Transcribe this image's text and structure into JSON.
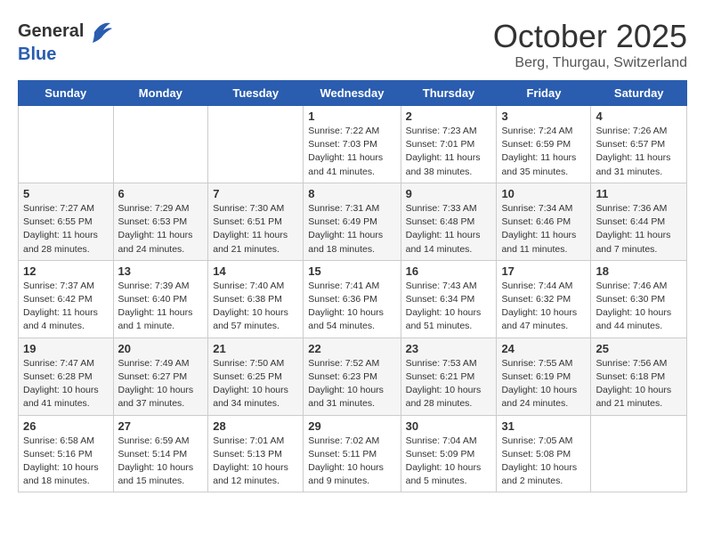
{
  "logo": {
    "general": "General",
    "blue": "Blue"
  },
  "title": "October 2025",
  "location": "Berg, Thurgau, Switzerland",
  "days_header": [
    "Sunday",
    "Monday",
    "Tuesday",
    "Wednesday",
    "Thursday",
    "Friday",
    "Saturday"
  ],
  "weeks": [
    [
      {
        "num": "",
        "info": ""
      },
      {
        "num": "",
        "info": ""
      },
      {
        "num": "",
        "info": ""
      },
      {
        "num": "1",
        "info": "Sunrise: 7:22 AM\nSunset: 7:03 PM\nDaylight: 11 hours\nand 41 minutes."
      },
      {
        "num": "2",
        "info": "Sunrise: 7:23 AM\nSunset: 7:01 PM\nDaylight: 11 hours\nand 38 minutes."
      },
      {
        "num": "3",
        "info": "Sunrise: 7:24 AM\nSunset: 6:59 PM\nDaylight: 11 hours\nand 35 minutes."
      },
      {
        "num": "4",
        "info": "Sunrise: 7:26 AM\nSunset: 6:57 PM\nDaylight: 11 hours\nand 31 minutes."
      }
    ],
    [
      {
        "num": "5",
        "info": "Sunrise: 7:27 AM\nSunset: 6:55 PM\nDaylight: 11 hours\nand 28 minutes."
      },
      {
        "num": "6",
        "info": "Sunrise: 7:29 AM\nSunset: 6:53 PM\nDaylight: 11 hours\nand 24 minutes."
      },
      {
        "num": "7",
        "info": "Sunrise: 7:30 AM\nSunset: 6:51 PM\nDaylight: 11 hours\nand 21 minutes."
      },
      {
        "num": "8",
        "info": "Sunrise: 7:31 AM\nSunset: 6:49 PM\nDaylight: 11 hours\nand 18 minutes."
      },
      {
        "num": "9",
        "info": "Sunrise: 7:33 AM\nSunset: 6:48 PM\nDaylight: 11 hours\nand 14 minutes."
      },
      {
        "num": "10",
        "info": "Sunrise: 7:34 AM\nSunset: 6:46 PM\nDaylight: 11 hours\nand 11 minutes."
      },
      {
        "num": "11",
        "info": "Sunrise: 7:36 AM\nSunset: 6:44 PM\nDaylight: 11 hours\nand 7 minutes."
      }
    ],
    [
      {
        "num": "12",
        "info": "Sunrise: 7:37 AM\nSunset: 6:42 PM\nDaylight: 11 hours\nand 4 minutes."
      },
      {
        "num": "13",
        "info": "Sunrise: 7:39 AM\nSunset: 6:40 PM\nDaylight: 11 hours\nand 1 minute."
      },
      {
        "num": "14",
        "info": "Sunrise: 7:40 AM\nSunset: 6:38 PM\nDaylight: 10 hours\nand 57 minutes."
      },
      {
        "num": "15",
        "info": "Sunrise: 7:41 AM\nSunset: 6:36 PM\nDaylight: 10 hours\nand 54 minutes."
      },
      {
        "num": "16",
        "info": "Sunrise: 7:43 AM\nSunset: 6:34 PM\nDaylight: 10 hours\nand 51 minutes."
      },
      {
        "num": "17",
        "info": "Sunrise: 7:44 AM\nSunset: 6:32 PM\nDaylight: 10 hours\nand 47 minutes."
      },
      {
        "num": "18",
        "info": "Sunrise: 7:46 AM\nSunset: 6:30 PM\nDaylight: 10 hours\nand 44 minutes."
      }
    ],
    [
      {
        "num": "19",
        "info": "Sunrise: 7:47 AM\nSunset: 6:28 PM\nDaylight: 10 hours\nand 41 minutes."
      },
      {
        "num": "20",
        "info": "Sunrise: 7:49 AM\nSunset: 6:27 PM\nDaylight: 10 hours\nand 37 minutes."
      },
      {
        "num": "21",
        "info": "Sunrise: 7:50 AM\nSunset: 6:25 PM\nDaylight: 10 hours\nand 34 minutes."
      },
      {
        "num": "22",
        "info": "Sunrise: 7:52 AM\nSunset: 6:23 PM\nDaylight: 10 hours\nand 31 minutes."
      },
      {
        "num": "23",
        "info": "Sunrise: 7:53 AM\nSunset: 6:21 PM\nDaylight: 10 hours\nand 28 minutes."
      },
      {
        "num": "24",
        "info": "Sunrise: 7:55 AM\nSunset: 6:19 PM\nDaylight: 10 hours\nand 24 minutes."
      },
      {
        "num": "25",
        "info": "Sunrise: 7:56 AM\nSunset: 6:18 PM\nDaylight: 10 hours\nand 21 minutes."
      }
    ],
    [
      {
        "num": "26",
        "info": "Sunrise: 6:58 AM\nSunset: 5:16 PM\nDaylight: 10 hours\nand 18 minutes."
      },
      {
        "num": "27",
        "info": "Sunrise: 6:59 AM\nSunset: 5:14 PM\nDaylight: 10 hours\nand 15 minutes."
      },
      {
        "num": "28",
        "info": "Sunrise: 7:01 AM\nSunset: 5:13 PM\nDaylight: 10 hours\nand 12 minutes."
      },
      {
        "num": "29",
        "info": "Sunrise: 7:02 AM\nSunset: 5:11 PM\nDaylight: 10 hours\nand 9 minutes."
      },
      {
        "num": "30",
        "info": "Sunrise: 7:04 AM\nSunset: 5:09 PM\nDaylight: 10 hours\nand 5 minutes."
      },
      {
        "num": "31",
        "info": "Sunrise: 7:05 AM\nSunset: 5:08 PM\nDaylight: 10 hours\nand 2 minutes."
      },
      {
        "num": "",
        "info": ""
      }
    ]
  ]
}
